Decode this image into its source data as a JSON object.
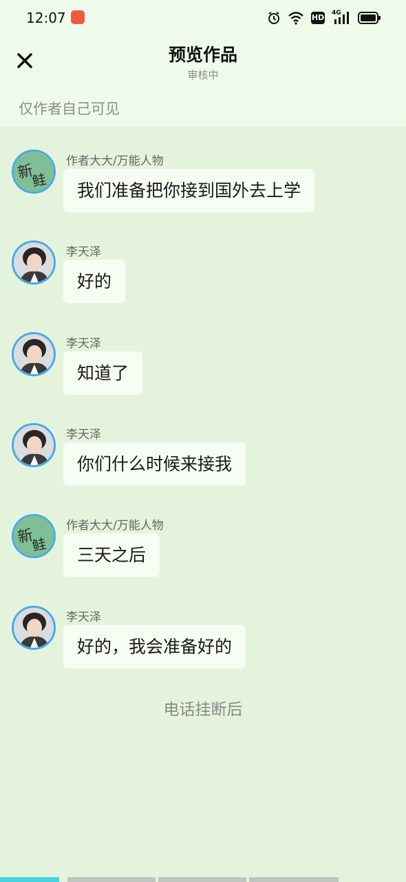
{
  "status_bar": {
    "time": "12:07",
    "network_label": "4G",
    "hd_label": "HD"
  },
  "header": {
    "title": "预览作品",
    "subtitle": "审核中",
    "visibility_note": "仅作者自己可见"
  },
  "messages": [
    {
      "sender": "作者大大/万能人物",
      "text": "我们准备把你接到国外去上学",
      "avatar": "author-avatar"
    },
    {
      "sender": "李天泽",
      "text": "好的",
      "avatar": "character-avatar"
    },
    {
      "sender": "李天泽",
      "text": "知道了",
      "avatar": "character-avatar"
    },
    {
      "sender": "李天泽",
      "text": "你们什么时候来接我",
      "avatar": "character-avatar"
    },
    {
      "sender": "作者大大/万能人物",
      "text": "三天之后",
      "avatar": "author-avatar"
    },
    {
      "sender": "李天泽",
      "text": "好的，我会准备好的",
      "avatar": "character-avatar"
    }
  ],
  "scene_note": "电话挂断后",
  "progress": {
    "segments": 4,
    "active_segment": 1
  },
  "colors": {
    "header_background": "#eefbea",
    "chat_background": "#e4f4dc",
    "bubble_background": "#f6fdf3",
    "avatar_border": "#4aa9e8",
    "progress_active": "#46d3df",
    "progress_inactive": "#bfc6c0"
  }
}
